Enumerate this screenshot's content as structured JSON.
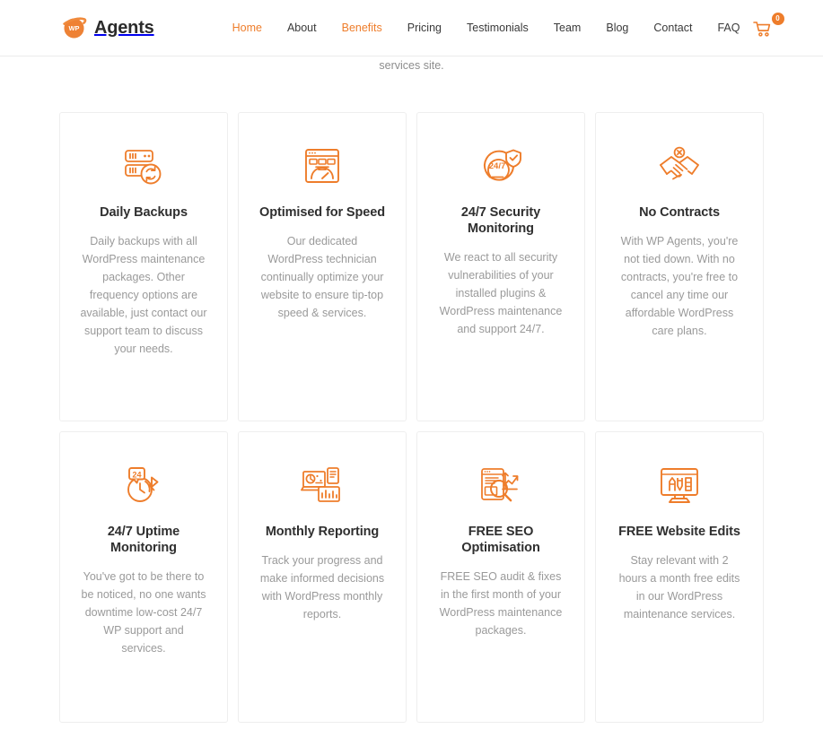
{
  "colors": {
    "accent": "#ee7d2b",
    "heading": "#2f2f2f",
    "body_text": "#9a9a9a",
    "card_border": "#eeeeee",
    "page_bg": "#ffffff"
  },
  "header": {
    "brand": {
      "mark_text": "WP",
      "name": "Agents",
      "icon": "wp-planet-logo-icon"
    },
    "nav": [
      {
        "label": "Home",
        "active": true
      },
      {
        "label": "About",
        "active": false
      },
      {
        "label": "Benefits",
        "active": true
      },
      {
        "label": "Pricing",
        "active": false
      },
      {
        "label": "Testimonials",
        "active": false
      },
      {
        "label": "Team",
        "active": false
      },
      {
        "label": "Blog",
        "active": false
      },
      {
        "label": "Contact",
        "active": false
      },
      {
        "label": "FAQ",
        "active": false
      }
    ],
    "cart": {
      "icon": "shopping-cart-icon",
      "count": "0"
    }
  },
  "intro": {
    "text": "services site."
  },
  "features": {
    "row1": [
      {
        "icon": "server-backup-icon",
        "title": "Daily Backups",
        "text": "Daily backups with all WordPress maintenance packages. Other frequency options are available, just contact our support team to discuss your needs."
      },
      {
        "icon": "browser-speed-gauge-icon",
        "title": "Optimised for Speed",
        "text": "Our dedicated WordPress technician continually optimize your website to ensure tip-top speed & services."
      },
      {
        "icon": "security-247-shield-icon",
        "title": "24/7 Security Monitoring",
        "text": "We react to all security vulnerabilities of your installed plugins & WordPress maintenance and support 24/7."
      },
      {
        "icon": "handshake-no-contract-icon",
        "title": "No Contracts",
        "text": "With WP Agents, you're not tied down. With no contracts, you're free to cancel any time our affordable WordPress care plans."
      }
    ],
    "row2": [
      {
        "icon": "uptime-24-clock-icon",
        "title": "24/7 Uptime Monitoring",
        "text": "You've got to be there to be noticed, no one wants downtime low-cost 24/7 WP support and services."
      },
      {
        "icon": "monthly-report-chart-icon",
        "title": "Monthly Reporting",
        "text": "Track your progress and make informed decisions with WordPress monthly reports."
      },
      {
        "icon": "seo-magnifier-growth-icon",
        "title": "FREE SEO Optimisation",
        "text": "FREE SEO audit & fixes in the first month of your WordPress maintenance packages."
      },
      {
        "icon": "monitor-website-edit-icon",
        "title": "FREE Website Edits",
        "text": "Stay relevant with 2 hours a month free edits in our WordPress maintenance services."
      }
    ]
  }
}
